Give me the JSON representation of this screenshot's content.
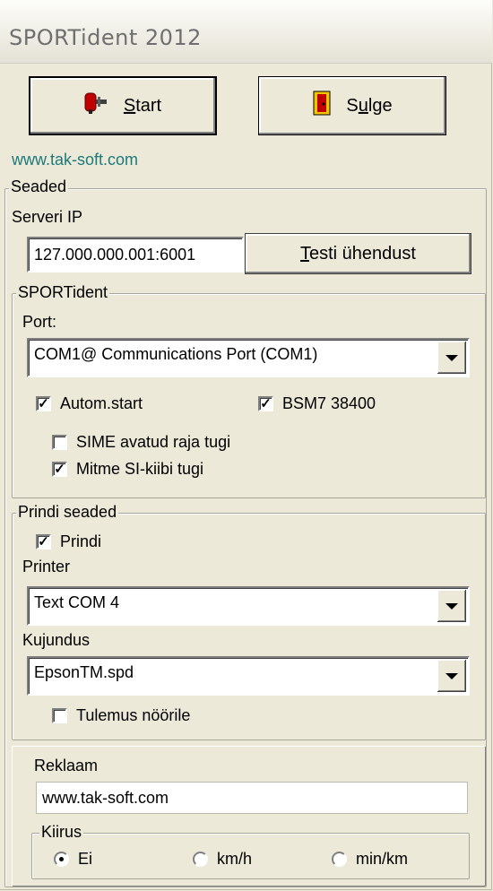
{
  "window": {
    "title": "SPORTident 2012"
  },
  "buttons": {
    "start": "Start",
    "start_ul": "S",
    "close": "Sulge",
    "close_pre": "S",
    "close_ul": "u"
  },
  "link": "www.tak-soft.com",
  "seaded": {
    "title": "Seaded",
    "server_label": "Serveri IP",
    "server_value": "127.000.000.001:6001",
    "test_button": "Testi ühendust"
  },
  "sportident": {
    "title": "SPORTident",
    "port_label": "Port:",
    "port_value": "COM1@ Communications Port (COM1)",
    "autom_start": {
      "label": "Autom.start",
      "checked": true
    },
    "bsm7": {
      "label": "BSM7 38400",
      "checked": true
    },
    "sime": {
      "label": "SIME avatud raja tugi",
      "checked": false
    },
    "mitme": {
      "label": "Mitme SI-kiibi tugi",
      "checked": true
    }
  },
  "print": {
    "title": "Prindi seaded",
    "prindi": {
      "label": "Prindi",
      "checked": true
    },
    "printer_label": "Printer",
    "printer_value": "Text COM 4",
    "kujundus_label": "Kujundus",
    "kujundus_value": "EpsonTM.spd",
    "tulemus": {
      "label": "Tulemus nöörile",
      "checked": false
    }
  },
  "reklaam": {
    "title": "Reklaam",
    "value": "www.tak-soft.com",
    "kiirus": {
      "title": "Kiirus",
      "options": [
        "Ei",
        "km/h",
        "min/km"
      ],
      "selected": "Ei"
    }
  }
}
